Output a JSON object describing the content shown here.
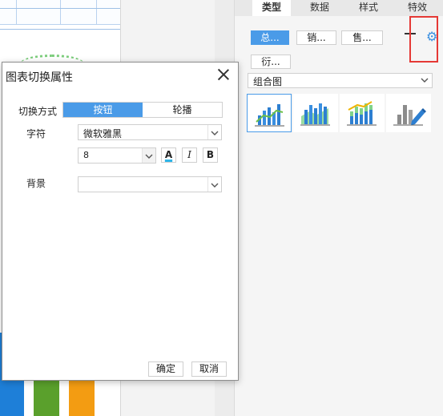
{
  "panel": {
    "tabs": [
      "类型",
      "数据",
      "样式",
      "特效"
    ],
    "series_chips": [
      "总...",
      "销...",
      "售...",
      "衍..."
    ],
    "chart_type": "组合图",
    "thumbnails": [
      "combo-bar-line-icon",
      "combo-bar-area-icon",
      "stacked-bar-line-icon",
      "custom-chart-edit-icon"
    ],
    "add_icon": "plus-icon",
    "settings_icon": "gear-icon",
    "highlight_color": "#e53935"
  },
  "dialog": {
    "title": "图表切换属性",
    "switch_mode_label": "切换方式",
    "switch_modes": [
      "按钮",
      "轮播"
    ],
    "font_label": "字符",
    "font_value": "微软雅黑",
    "size_value": "8",
    "format_buttons": [
      "A",
      "I",
      "B"
    ],
    "background_label": "背景",
    "background_value": "",
    "ok_label": "确定",
    "cancel_label": "取消",
    "accent_color": "#4a9be8"
  }
}
